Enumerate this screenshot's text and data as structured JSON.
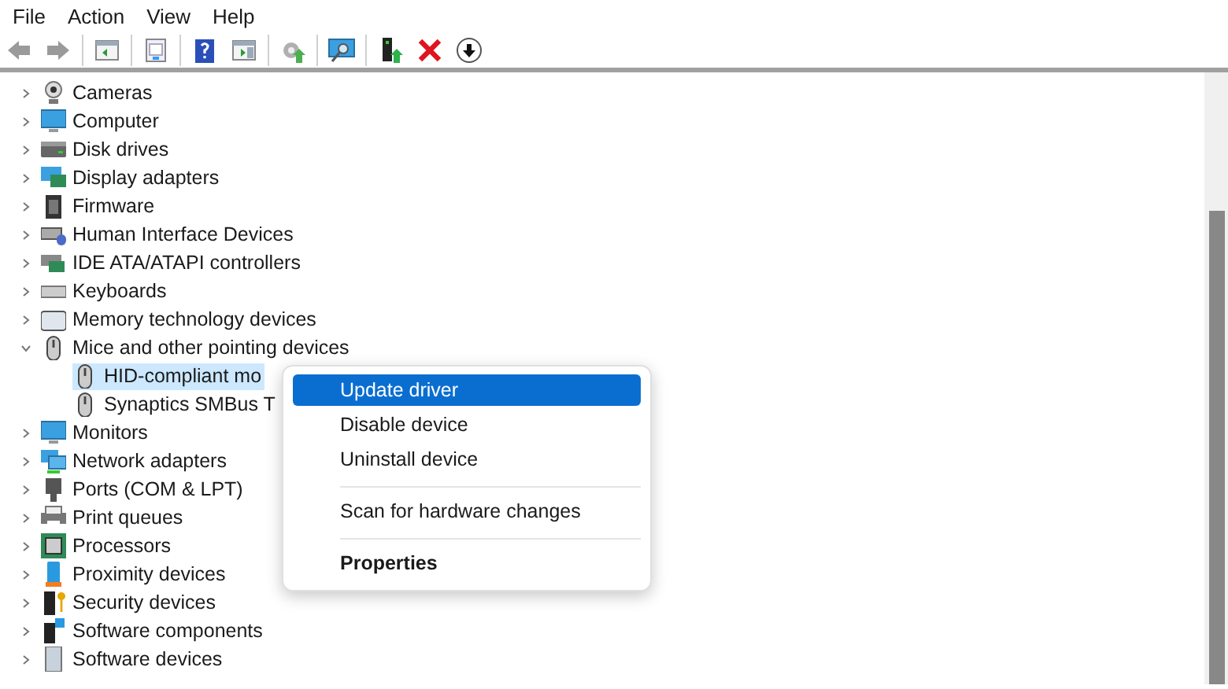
{
  "menu": [
    {
      "label": "File"
    },
    {
      "label": "Action"
    },
    {
      "label": "View"
    },
    {
      "label": "Help"
    }
  ],
  "toolbar": [
    {
      "kind": "back"
    },
    {
      "kind": "forward"
    },
    {
      "kind": "sep"
    },
    {
      "kind": "tree"
    },
    {
      "kind": "sep"
    },
    {
      "kind": "props"
    },
    {
      "kind": "sep"
    },
    {
      "kind": "help"
    },
    {
      "kind": "pane"
    },
    {
      "kind": "sep"
    },
    {
      "kind": "update"
    },
    {
      "kind": "sep"
    },
    {
      "kind": "scan"
    },
    {
      "kind": "sep"
    },
    {
      "kind": "enable"
    },
    {
      "kind": "uninstall"
    },
    {
      "kind": "disable"
    }
  ],
  "tree": [
    {
      "label": "Cameras",
      "expanded": false
    },
    {
      "label": "Computer",
      "expanded": false
    },
    {
      "label": "Disk drives",
      "expanded": false
    },
    {
      "label": "Display adapters",
      "expanded": false
    },
    {
      "label": "Firmware",
      "expanded": false
    },
    {
      "label": "Human Interface Devices",
      "expanded": false
    },
    {
      "label": "IDE ATA/ATAPI controllers",
      "expanded": false
    },
    {
      "label": "Keyboards",
      "expanded": false
    },
    {
      "label": "Memory technology devices",
      "expanded": false
    },
    {
      "label": "Mice and other pointing devices",
      "expanded": true,
      "children": [
        {
          "label": "HID-compliant mo",
          "selected": true
        },
        {
          "label": "Synaptics SMBus T",
          "selected": false
        }
      ]
    },
    {
      "label": "Monitors",
      "expanded": false
    },
    {
      "label": "Network adapters",
      "expanded": false
    },
    {
      "label": "Ports (COM & LPT)",
      "expanded": false
    },
    {
      "label": "Print queues",
      "expanded": false
    },
    {
      "label": "Processors",
      "expanded": false
    },
    {
      "label": "Proximity devices",
      "expanded": false
    },
    {
      "label": "Security devices",
      "expanded": false
    },
    {
      "label": "Software components",
      "expanded": false
    },
    {
      "label": "Software devices",
      "expanded": false
    }
  ],
  "context_menu": [
    {
      "kind": "item",
      "label": "Update driver",
      "selected": true
    },
    {
      "kind": "item",
      "label": "Disable device",
      "selected": false
    },
    {
      "kind": "item",
      "label": "Uninstall device",
      "selected": false
    },
    {
      "kind": "separator"
    },
    {
      "kind": "item",
      "label": "Scan for hardware changes",
      "selected": false
    },
    {
      "kind": "separator"
    },
    {
      "kind": "default",
      "label": "Properties",
      "selected": false
    }
  ]
}
